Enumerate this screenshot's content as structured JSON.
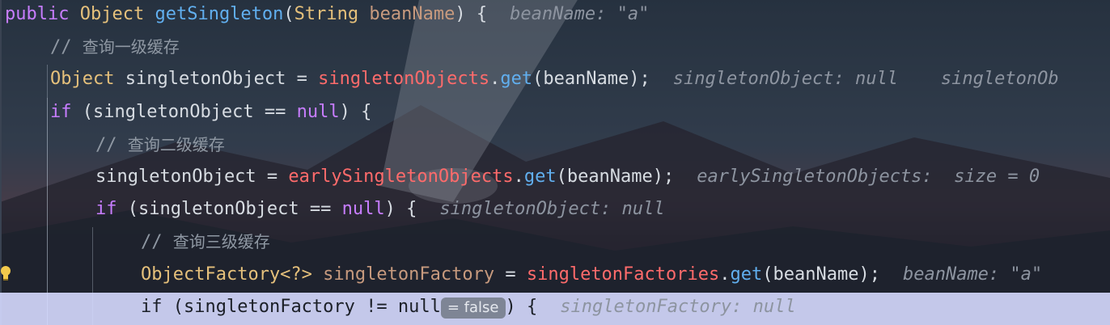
{
  "colors": {
    "keyword": "#c77dff",
    "type": "#e5c07b",
    "method": "#61afef",
    "field": "#ff6b6b",
    "param": "#c79a7e",
    "text": "#d7dce2",
    "comment": "#8f98a3",
    "string_hint": "#8d94a0"
  },
  "icons": {
    "bulb": "lightbulb-icon"
  },
  "code_lines": [
    {
      "indent": 0,
      "tokens": [
        {
          "t": "public",
          "c": "keyword"
        },
        {
          "t": " ",
          "c": "text"
        },
        {
          "t": "Object",
          "c": "type"
        },
        {
          "t": " ",
          "c": "text"
        },
        {
          "t": "getSingleton",
          "c": "method"
        },
        {
          "t": "(",
          "c": "text"
        },
        {
          "t": "String",
          "c": "type"
        },
        {
          "t": " ",
          "c": "text"
        },
        {
          "t": "beanName",
          "c": "param"
        },
        {
          "t": ") {",
          "c": "text"
        }
      ],
      "hint": "beanName: \"a\""
    },
    {
      "indent": 1,
      "tokens": [
        {
          "t": "// ",
          "c": "comment"
        },
        {
          "t": "查询一级缓存",
          "c": "comment"
        }
      ],
      "hint": ""
    },
    {
      "indent": 1,
      "tokens": [
        {
          "t": "Object",
          "c": "type"
        },
        {
          "t": " singletonObject = ",
          "c": "text"
        },
        {
          "t": "singletonObjects",
          "c": "field"
        },
        {
          "t": ".",
          "c": "text"
        },
        {
          "t": "get",
          "c": "method"
        },
        {
          "t": "(beanName);",
          "c": "text"
        }
      ],
      "hint": "singletonObject: null    singletonOb"
    },
    {
      "indent": 1,
      "tokens": [
        {
          "t": "if",
          "c": "keyword"
        },
        {
          "t": " (singletonObject == ",
          "c": "text"
        },
        {
          "t": "null",
          "c": "keyword"
        },
        {
          "t": ") {",
          "c": "text"
        }
      ],
      "hint": ""
    },
    {
      "indent": 2,
      "tokens": [
        {
          "t": "// ",
          "c": "comment"
        },
        {
          "t": "查询二级缓存",
          "c": "comment"
        }
      ],
      "hint": ""
    },
    {
      "indent": 2,
      "tokens": [
        {
          "t": "singletonObject = ",
          "c": "text"
        },
        {
          "t": "earlySingletonObjects",
          "c": "field"
        },
        {
          "t": ".",
          "c": "text"
        },
        {
          "t": "get",
          "c": "method"
        },
        {
          "t": "(beanName);",
          "c": "text"
        }
      ],
      "hint": "earlySingletonObjects:  size = 0"
    },
    {
      "indent": 2,
      "tokens": [
        {
          "t": "if",
          "c": "keyword"
        },
        {
          "t": " (singletonObject == ",
          "c": "text"
        },
        {
          "t": "null",
          "c": "keyword"
        },
        {
          "t": ") {",
          "c": "text"
        }
      ],
      "hint": "singletonObject: null"
    },
    {
      "indent": 3,
      "tokens": [
        {
          "t": "// ",
          "c": "comment"
        },
        {
          "t": "查询三级缓存",
          "c": "comment"
        }
      ],
      "hint": ""
    },
    {
      "indent": 3,
      "tokens": [
        {
          "t": "ObjectFactory<?>",
          "c": "type"
        },
        {
          "t": " ",
          "c": "text"
        },
        {
          "t": "singletonFactory",
          "c": "param"
        },
        {
          "t": " = ",
          "c": "text"
        },
        {
          "t": "singletonFactories",
          "c": "field"
        },
        {
          "t": ".",
          "c": "text"
        },
        {
          "t": "get",
          "c": "method"
        },
        {
          "t": "(beanName);",
          "c": "text"
        }
      ],
      "hint": "beanName: \"a\""
    },
    {
      "indent": 3,
      "highlight": true,
      "tokens": [
        {
          "t": "if",
          "c": "text"
        },
        {
          "t": " (singletonFactory != null",
          "c": "text"
        }
      ],
      "inline_eval": "= false",
      "after_eval": ") {",
      "hint": "singletonFactory: null"
    }
  ]
}
